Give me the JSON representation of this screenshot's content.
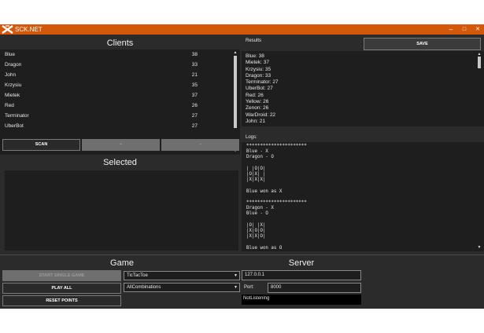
{
  "window": {
    "title": "SCK.NET",
    "minimize": "–",
    "maximize": "□",
    "close": "✕"
  },
  "clients": {
    "heading": "Clients",
    "items": [
      {
        "name": "Blue",
        "value": "38"
      },
      {
        "name": "Dragon",
        "value": "33"
      },
      {
        "name": "John",
        "value": "21"
      },
      {
        "name": "Krzysiu",
        "value": "35"
      },
      {
        "name": "Mietek",
        "value": "37"
      },
      {
        "name": "Red",
        "value": "26"
      },
      {
        "name": "Terminator",
        "value": "27"
      },
      {
        "name": "UberBot",
        "value": "27"
      }
    ],
    "scan_label": "SCAN",
    "add_label": "+",
    "remove_label": "−"
  },
  "selected": {
    "heading": "Selected"
  },
  "results": {
    "heading": "Results",
    "save_label": "SAVE",
    "lines": [
      "Blue: 38",
      "Mietek: 37",
      "Krzysiu: 35",
      "Dragon: 33",
      "Terminator: 27",
      "UberBot: 27",
      "Red: 26",
      "Yellow: 26",
      "Zenon: 26",
      "WarDroid: 22",
      "John: 21"
    ]
  },
  "logs": {
    "heading": "Logs:",
    "text": "**********************\nBlue - X\nDragon - O\n\n| |O|O|\n|O|X| |\n|X|X|X|\n\nBlue won as X\n\n**********************\nDragon - X\nBlue - O\n\n|O| |X|\n|X|O|O|\n|X|X|O|\n\nBlue won as O"
  },
  "game": {
    "heading": "Game",
    "start_single_label": "START SINGLE GAME",
    "play_all_label": "PLAY ALL",
    "reset_points_label": "RESET POINTS",
    "game_type": "TicTacToe",
    "mode": "AllCombinations"
  },
  "server": {
    "heading": "Server",
    "ip": "127.0.0.1",
    "port_label": "Port:",
    "port": "8000",
    "status": "NotListening"
  },
  "colors": {
    "accent": "#d4580a",
    "background": "#2b2b2b",
    "panel": "#1e1e1e"
  }
}
